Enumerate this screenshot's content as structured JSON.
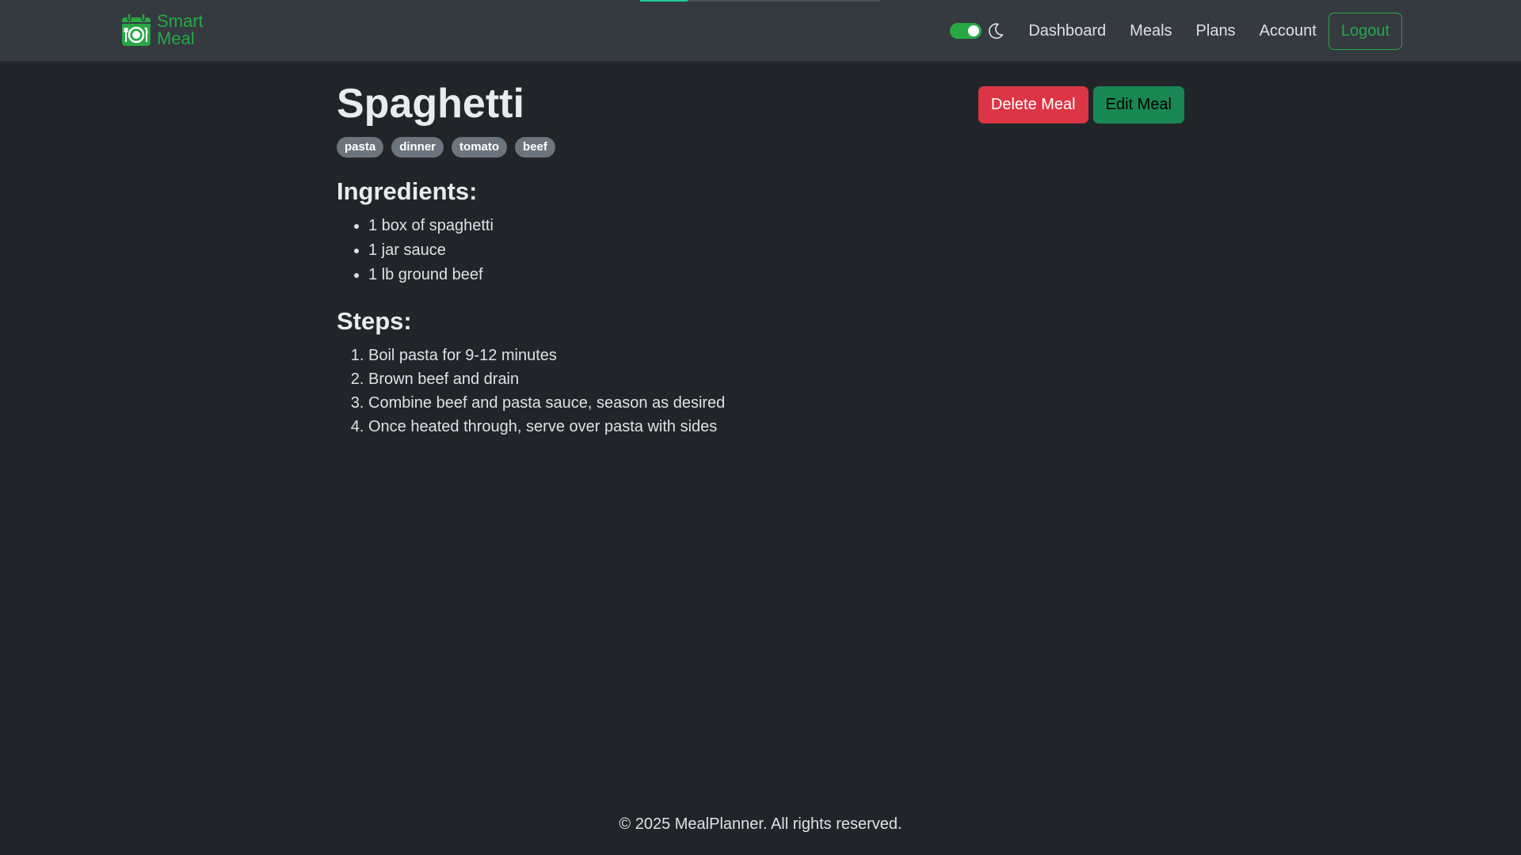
{
  "nav": {
    "brand_line1": "Smart",
    "brand_line2": "Meal",
    "logo_icon": "calendar-plate-icon",
    "theme_toggle_on": true,
    "theme_icon": "moon-icon",
    "links": [
      "Dashboard",
      "Meals",
      "Plans",
      "Account"
    ],
    "logout_label": "Logout",
    "progress_fraction": 0.2
  },
  "meal": {
    "title": "Spaghetti",
    "tags": [
      "pasta",
      "dinner",
      "tomato",
      "beef"
    ],
    "delete_label": "Delete Meal",
    "edit_label": "Edit Meal",
    "ingredients_heading": "Ingredients:",
    "ingredients": [
      "1 box of spaghetti",
      "1 jar sauce",
      "1 lb ground beef"
    ],
    "steps_heading": "Steps:",
    "steps": [
      "Boil pasta for 9-12 minutes",
      "Brown beef and drain",
      "Combine beef and pasta sauce, season as desired",
      "Once heated through, serve over pasta with sides"
    ]
  },
  "footer": {
    "text": "© 2025 MealPlanner. All rights reserved."
  },
  "colors": {
    "background": "#212529",
    "navbar": "#343a40",
    "accent_green": "#28a745",
    "danger": "#dc3545",
    "success": "#198754",
    "tag": "#6c757d",
    "progress": "#20c997"
  }
}
